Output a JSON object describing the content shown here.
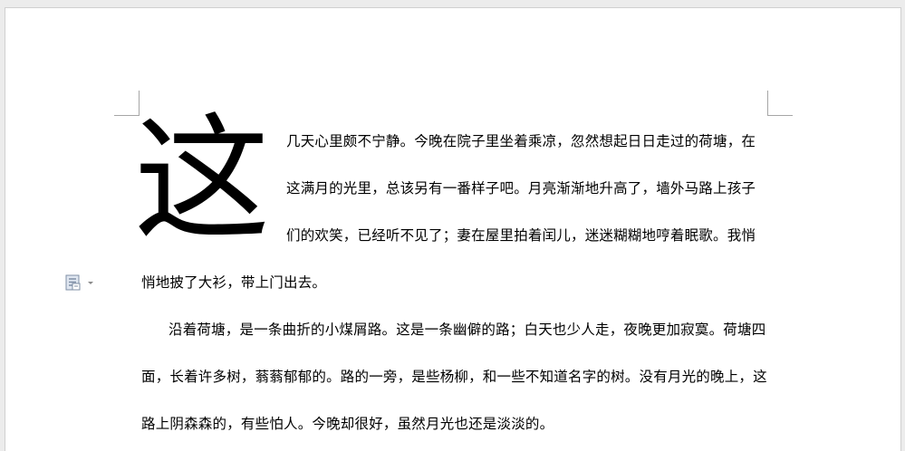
{
  "document": {
    "dropcap": "这",
    "paragraph1": {
      "lines": [
        "几天心里颇不宁静。今晚在院子里坐着乘凉，忽然想起日日走过的荷塘，在",
        "这满月的光里，总该另有一番样子吧。月亮渐渐地升高了，墙外马路上孩子",
        "们的欢笑，已经听不见了；妻在屋里拍着闰儿，迷迷糊糊地哼着眠歌。我悄",
        "悄地披了大衫，带上门出去。"
      ]
    },
    "paragraph2": {
      "lines": [
        "沿着荷塘，是一条曲折的小煤屑路。这是一条幽僻的路；白天也少人走，夜晚更加寂寞。荷塘四",
        "面，长着许多树，蓊蓊郁郁的。路的一旁，是些杨柳，和一些不知道名字的树。没有月光的晚上，这",
        "路上阴森森的，有些怕人。今晚却很好，虽然月光也还是淡淡的。"
      ]
    }
  },
  "icons": {
    "paragraph_options": "paragraph-options-icon",
    "dropdown": "chevron-down-icon"
  },
  "colors": {
    "background": "#ececec",
    "page": "#ffffff",
    "text": "#000000",
    "crop_marks": "#a6a6a6",
    "icon": "#7f8fa6"
  }
}
